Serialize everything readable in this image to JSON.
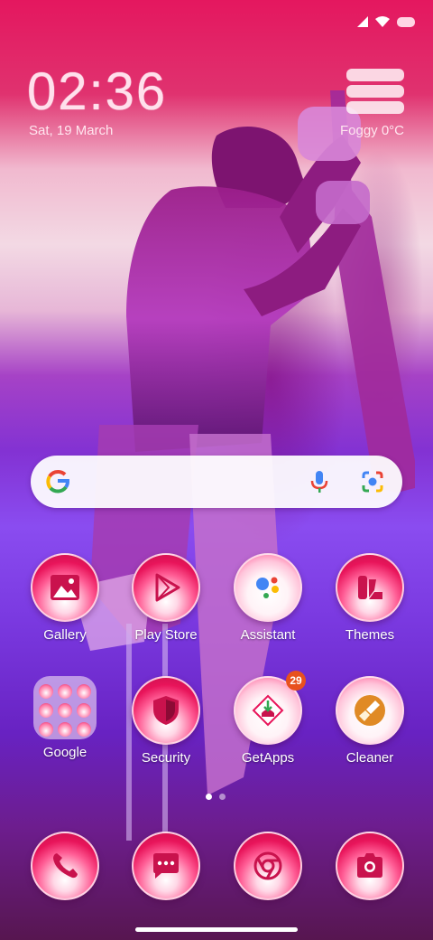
{
  "status": {
    "icons": [
      "signal-icon",
      "wifi-icon",
      "battery-icon"
    ]
  },
  "clock": {
    "time": "02:36",
    "date": "Sat, 19 March"
  },
  "weather": {
    "text": "Foggy  0°C",
    "icon": "fog-icon"
  },
  "search": {
    "icons": [
      "google-g-icon",
      "mic-icon",
      "lens-icon"
    ]
  },
  "apps": {
    "row1": [
      {
        "label": "Gallery",
        "icon": "gallery-icon"
      },
      {
        "label": "Play Store",
        "icon": "play-store-icon"
      },
      {
        "label": "Assistant",
        "icon": "assistant-icon"
      },
      {
        "label": "Themes",
        "icon": "themes-icon"
      }
    ],
    "row2": [
      {
        "label": "Google",
        "icon": "google-folder-icon"
      },
      {
        "label": "Security",
        "icon": "security-shield-icon"
      },
      {
        "label": "GetApps",
        "icon": "getapps-icon",
        "badge": "29"
      },
      {
        "label": "Cleaner",
        "icon": "cleaner-brush-icon"
      }
    ]
  },
  "dock": [
    "phone-icon",
    "messages-icon",
    "chrome-icon",
    "camera-icon"
  ],
  "colors": {
    "accent": "#e8145a",
    "badge": "#e8511e"
  }
}
